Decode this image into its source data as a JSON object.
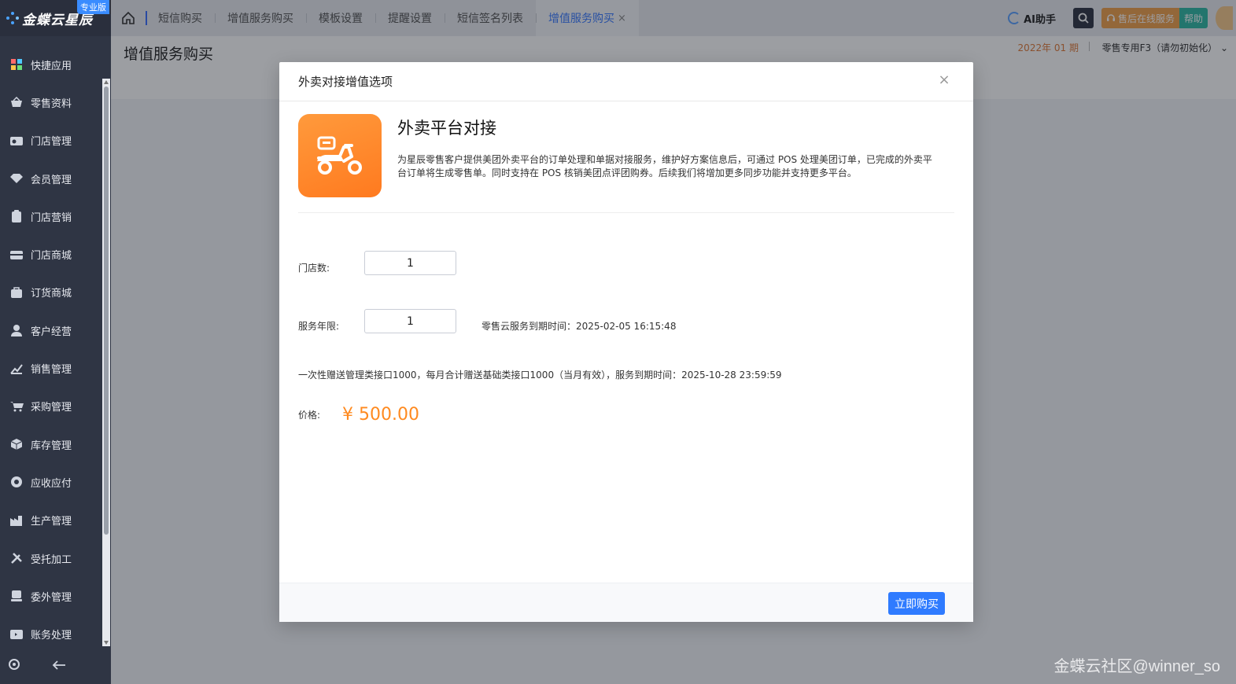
{
  "brand": {
    "logo_text": "金蝶云星辰",
    "edition": "专业版"
  },
  "sidebar": {
    "items": [
      {
        "label": "快捷应用",
        "icon": "grid-icon"
      },
      {
        "label": "零售资料",
        "icon": "basket-icon"
      },
      {
        "label": "门店管理",
        "icon": "store-icon"
      },
      {
        "label": "会员管理",
        "icon": "diamond-icon"
      },
      {
        "label": "门店营销",
        "icon": "clipboard-icon"
      },
      {
        "label": "门店商城",
        "icon": "shop-icon"
      },
      {
        "label": "订货商城",
        "icon": "bag-icon"
      },
      {
        "label": "客户经营",
        "icon": "user-icon"
      },
      {
        "label": "销售管理",
        "icon": "chart-icon"
      },
      {
        "label": "采购管理",
        "icon": "cart-icon"
      },
      {
        "label": "库存管理",
        "icon": "box-icon"
      },
      {
        "label": "应收应付",
        "icon": "money-icon"
      },
      {
        "label": "生产管理",
        "icon": "factory-icon"
      },
      {
        "label": "受托加工",
        "icon": "tools-icon"
      },
      {
        "label": "委外管理",
        "icon": "stack-icon"
      },
      {
        "label": "账务处理",
        "icon": "ledger-icon"
      }
    ],
    "bottom": {
      "settings_icon": "gear-icon",
      "collapse_icon": "arrow-left-icon"
    }
  },
  "tabs": [
    {
      "label": "短信购买",
      "active": false
    },
    {
      "label": "增值服务购买",
      "active": false
    },
    {
      "label": "模板设置",
      "active": false
    },
    {
      "label": "提醒设置",
      "active": false
    },
    {
      "label": "短信签名列表",
      "active": false
    },
    {
      "label": "增值服务购买",
      "active": true
    }
  ],
  "topbar": {
    "ai_label": "AI助手",
    "service_label": "售后在线服务",
    "help_label": "帮助",
    "tab_close": "×"
  },
  "page": {
    "title": "增值服务购买",
    "period": "2022年 01 期",
    "org": "零售专用F3（请勿初始化）"
  },
  "modal": {
    "title": "外卖对接增值选项",
    "close": "×",
    "product_name": "外卖平台对接",
    "product_desc": "为星辰零售客户提供美团外卖平台的订单处理和单据对接服务，维护好方案信息后，可通过 POS 处理美团订单，已完成的外卖平台订单将生成零售单。同时支持在 POS 核销美团点评团购券。后续我们将增加更多同步功能并支持更多平台。",
    "store_count_label": "门店数:",
    "store_count_value": "1",
    "service_years_label": "服务年限:",
    "service_years_value": "1",
    "expiry_text": "零售云服务到期时间：2025-02-05 16:15:48",
    "gift_text": "一次性赠送管理类接口1000，每月合计赠送基础类接口1000（当月有效），服务到期时间：2025-10-28 23:59:59",
    "price_label": "价格:",
    "price_value": "¥ 500.00",
    "buy_label": "立即购买"
  },
  "signature": "金蝶云社区@winner_so"
}
